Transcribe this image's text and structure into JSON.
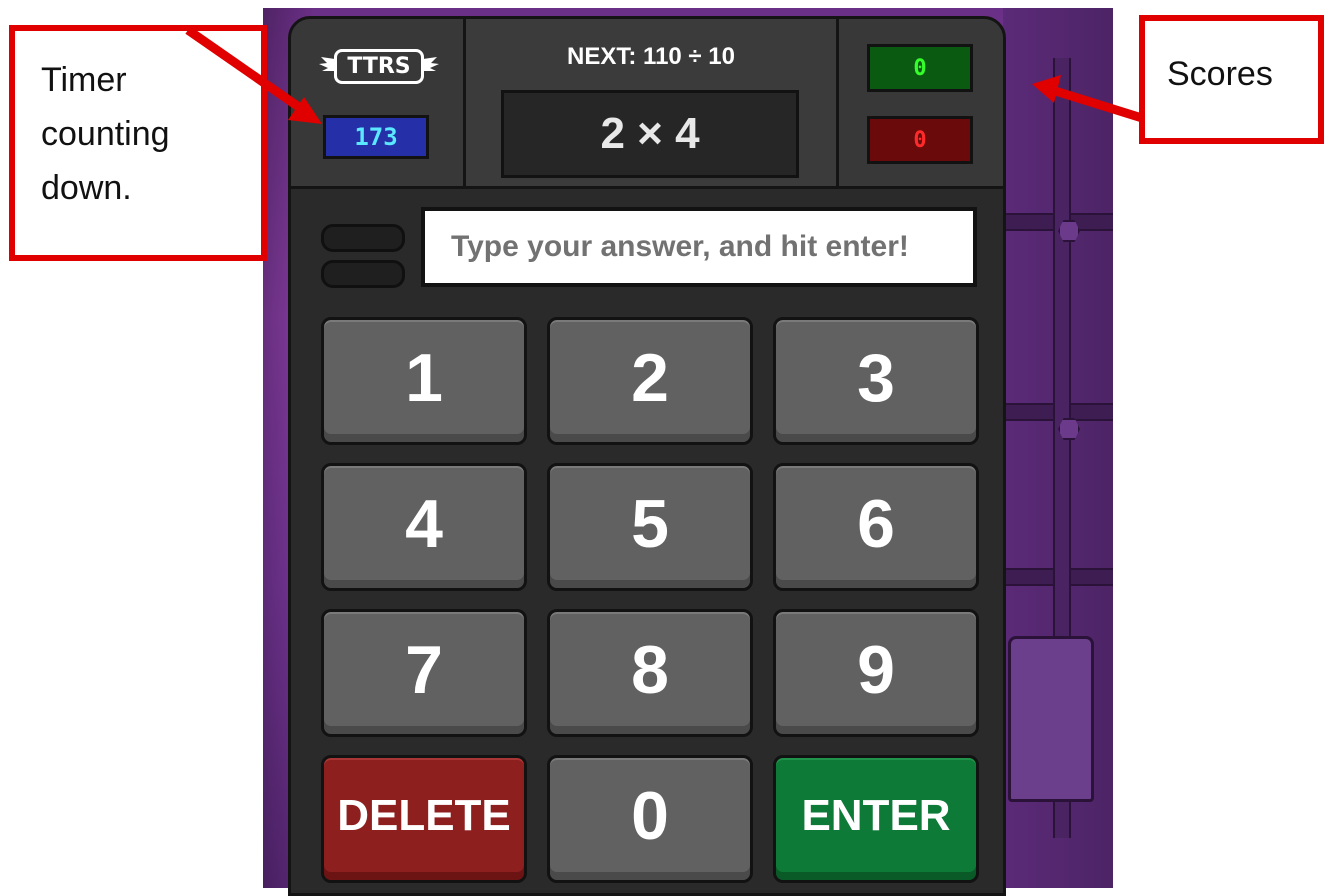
{
  "annotations": {
    "timer_note": "Timer counting down.",
    "scores_note": "Scores"
  },
  "game": {
    "logo_text": "TTRS",
    "timer": "173",
    "next_question": "NEXT: 110 ÷ 10",
    "current_question": "2 × 4",
    "score_correct": "0",
    "score_wrong": "0",
    "answer_placeholder": "Type your answer, and hit enter!",
    "answer_value": "",
    "keys": {
      "k1": "1",
      "k2": "2",
      "k3": "3",
      "k4": "4",
      "k5": "5",
      "k6": "6",
      "k7": "7",
      "k8": "8",
      "k9": "9",
      "delete": "DELETE",
      "k0": "0",
      "enter": "ENTER"
    }
  },
  "colors": {
    "timer_bg": "#2530a8",
    "timer_text": "#5be7ff",
    "correct_bg": "#0b5a12",
    "correct_text": "#35ff2a",
    "wrong_bg": "#6a0a0a",
    "wrong_text": "#ff2a2a",
    "delete_key": "#8e1f1f",
    "enter_key": "#0e7a37",
    "annotation_red": "#e00000"
  }
}
